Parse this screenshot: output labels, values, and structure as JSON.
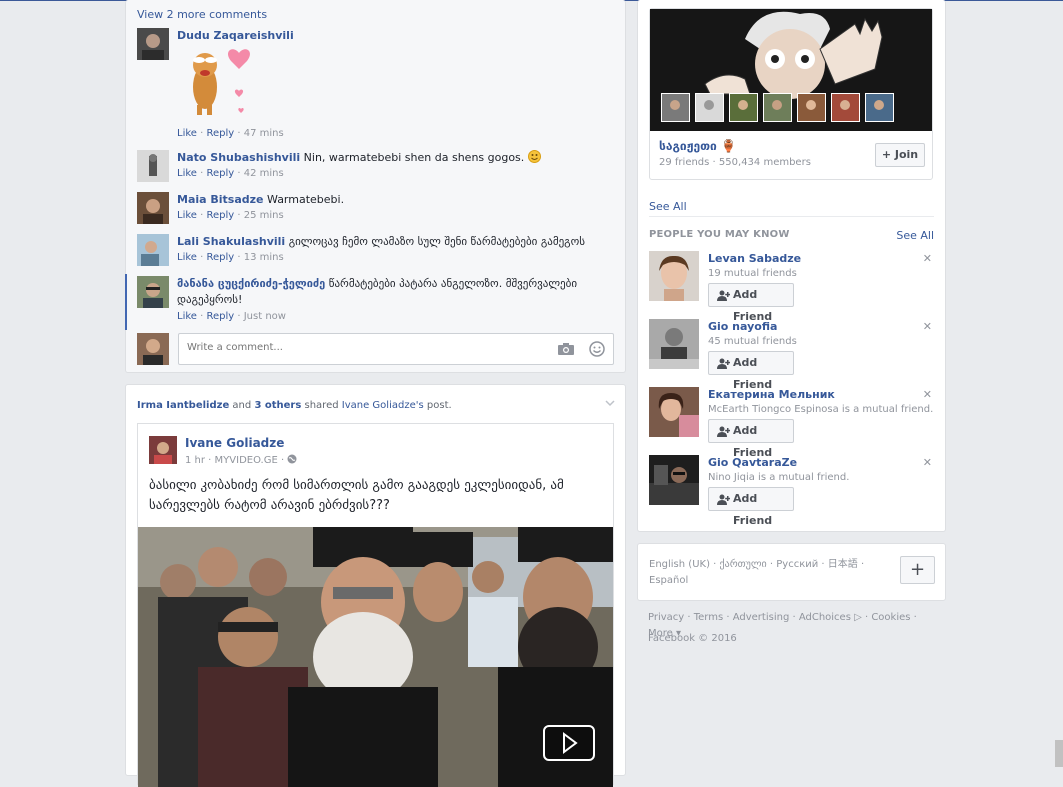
{
  "comments_section": {
    "view_more": "View 2 more comments",
    "like_label": "Like",
    "reply_label": "Reply",
    "comments": [
      {
        "name": "Dudu Zaqareishvili",
        "text": "",
        "time": "47 mins",
        "sticker": "dog-heart-sticker"
      },
      {
        "name": "Nato Shubashishvili",
        "text": "Nin, warmatebebi shen da shens gogos.",
        "time": "42 mins",
        "emoji": "smiley-emoji"
      },
      {
        "name": "Maia Bitsadze",
        "text": "Warmatebebi.",
        "time": "25 mins"
      },
      {
        "name": "Lali Shakulashvili",
        "text": "გილოცავ ჩემო ლამაზო სულ შენი წარმატებები გამეგოს",
        "time": "13 mins"
      },
      {
        "name": "მანანა ცუცქირიძე-ჭელიძე",
        "text": "წარმატებები პატარა ანგელოზო. მშვერვალები დაგეპყროს!",
        "time": "Just now"
      }
    ],
    "input_placeholder": "Write a comment..."
  },
  "shared_post": {
    "sharer": "Irma Iantbelidze",
    "and_text": "and",
    "others": "3 others",
    "shared_text": "shared",
    "original_author_possessive": "Ivane Goliadze's",
    "post_word": "post.",
    "author": "Ivane Goliadze",
    "time": "1 hr",
    "source": "MYVIDEO.GE",
    "text": "ბასილი კობახიძე რომ სიმართლის გამო გააგდეს ეკლესიიდან, ამ სარევლებს რატომ არავინ ებრძვის???"
  },
  "group": {
    "name": "საგიჟეთი 🏺",
    "friends": "29 friends",
    "members": "550,434 members",
    "join_label": "Join"
  },
  "see_all_label": "See All",
  "pymk": {
    "title": "PEOPLE YOU MAY KNOW",
    "see_all": "See All",
    "add_friend_label": "Add Friend",
    "people": [
      {
        "name": "Levan Sabadze",
        "sub": "19 mutual friends"
      },
      {
        "name": "Gio nayofia",
        "sub": "45 mutual friends"
      },
      {
        "name": "Екатерина Мельник",
        "sub": "McEarth Tiongco Espinosa is a mutual friend."
      },
      {
        "name": "Gio QavtaraZe",
        "sub": "Nino Jiqia is a mutual friend."
      }
    ]
  },
  "languages": {
    "line1": "English (UK) · ქართული · Русский · 日本語 ·",
    "line2": "Español"
  },
  "footer": {
    "links": "Privacy · Terms · Advertising · AdChoices ▷ · Cookies · More ▾",
    "copyright": "Facebook © 2016"
  },
  "colors": {
    "link": "#365899",
    "meta": "#90949c",
    "background": "#e9ebee",
    "highlight": "#4267b2"
  }
}
